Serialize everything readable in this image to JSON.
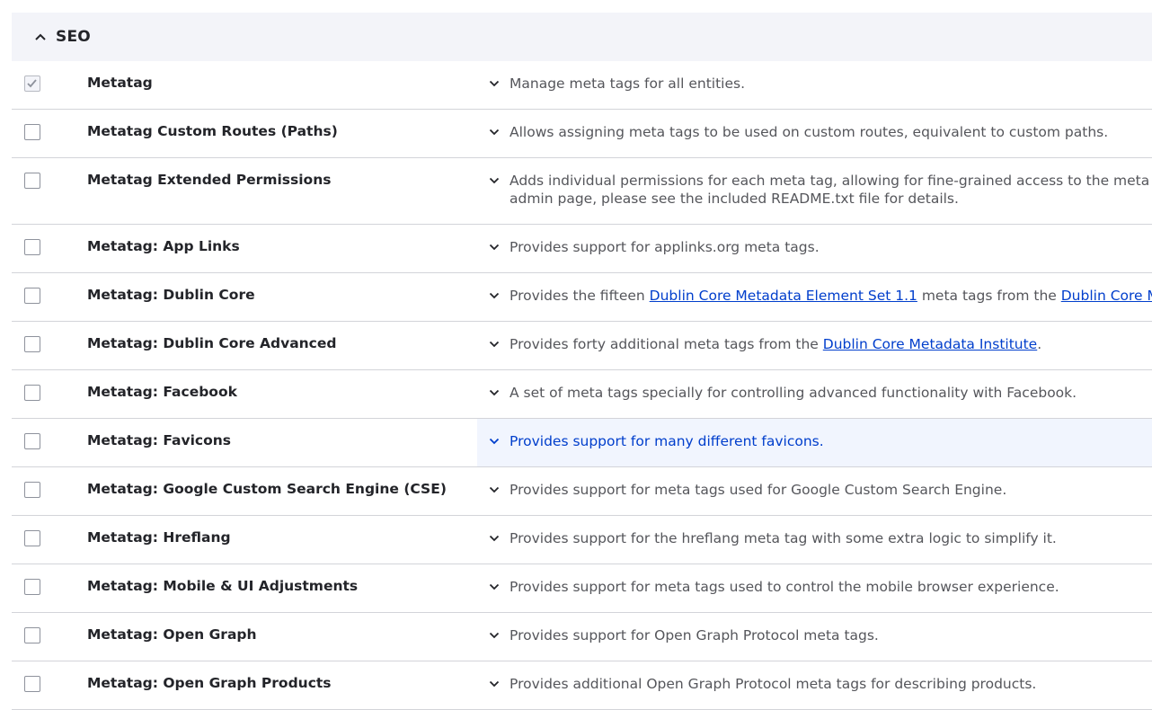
{
  "section": {
    "title": "SEO",
    "icon": "chevron-up-icon"
  },
  "colors": {
    "header_bg": "#f3f4f9",
    "link": "#003ecc",
    "hover_bg": "#f1f5fe",
    "border": "#d3d4d9"
  },
  "modules": [
    {
      "name": "Metatag",
      "checked": true,
      "disabled": true,
      "desc": [
        "Manage meta tags for all entities."
      ]
    },
    {
      "name": "Metatag Custom Routes (Paths)",
      "checked": false,
      "desc": [
        "Allows assigning meta tags to be used on custom routes, equivalent to custom paths."
      ]
    },
    {
      "name": "Metatag Extended Permissions",
      "checked": false,
      "desc": [
        "Adds individual permissions for each meta tag, allowing for fine-grained access to the meta tags. No",
        "admin page, please see the included README.txt file for details."
      ]
    },
    {
      "name": "Metatag: App Links",
      "checked": false,
      "desc": [
        "Provides support for applinks.org meta tags."
      ]
    },
    {
      "name": "Metatag: Dublin Core",
      "checked": false,
      "desc_parts": {
        "pre": "Provides the fifteen ",
        "link1": "Dublin Core Metadata Element Set 1.1",
        "mid": " meta tags from the ",
        "link2": "Dublin Core Metada"
      }
    },
    {
      "name": "Metatag: Dublin Core Advanced",
      "checked": false,
      "desc_parts": {
        "pre": "Provides forty additional meta tags from the ",
        "link1": "Dublin Core Metadata Institute",
        "post": "."
      }
    },
    {
      "name": "Metatag: Facebook",
      "checked": false,
      "desc": [
        "A set of meta tags specially for controlling advanced functionality with Facebook."
      ]
    },
    {
      "name": "Metatag: Favicons",
      "checked": false,
      "hover": true,
      "desc": [
        "Provides support for many different favicons."
      ]
    },
    {
      "name": "Metatag: Google Custom Search Engine (CSE)",
      "checked": false,
      "desc": [
        "Provides support for meta tags used for Google Custom Search Engine."
      ]
    },
    {
      "name": "Metatag: Hreflang",
      "checked": false,
      "desc": [
        "Provides support for the hreflang meta tag with some extra logic to simplify it."
      ]
    },
    {
      "name": "Metatag: Mobile & UI Adjustments",
      "checked": false,
      "desc": [
        "Provides support for meta tags used to control the mobile browser experience."
      ]
    },
    {
      "name": "Metatag: Open Graph",
      "checked": false,
      "desc": [
        "Provides support for Open Graph Protocol meta tags."
      ]
    },
    {
      "name": "Metatag: Open Graph Products",
      "checked": false,
      "desc": [
        "Provides additional Open Graph Protocol meta tags for describing products."
      ]
    }
  ]
}
